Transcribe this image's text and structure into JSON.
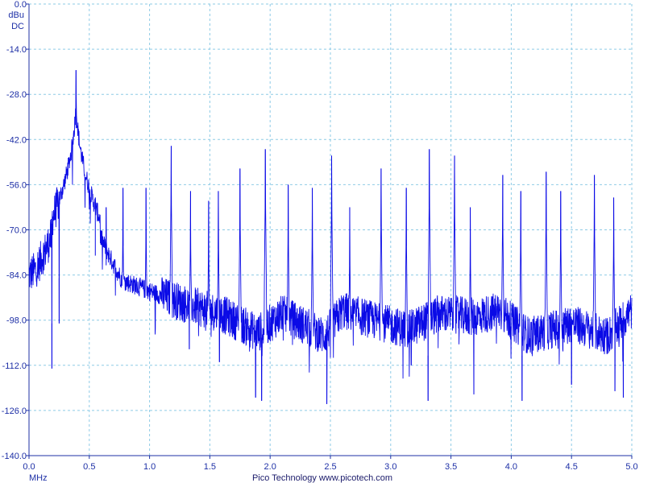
{
  "chart_data": {
    "type": "line",
    "y_unit": "dBu",
    "y_coupling": "DC",
    "x_unit": "MHz",
    "credit": "Pico Technology  www.picotech.com",
    "xlim": [
      0,
      5
    ],
    "ylim": [
      -140,
      0
    ],
    "x_ticks": [
      "0.0",
      "0.5",
      "1.0",
      "1.5",
      "2.0",
      "2.5",
      "3.0",
      "3.5",
      "4.0",
      "4.5",
      "5.0"
    ],
    "y_ticks": [
      "0.0",
      "-14.0",
      "-28.0",
      "-42.0",
      "-56.0",
      "-70.0",
      "-84.0",
      "-98.0",
      "-112.0",
      "-126.0",
      "-140.0"
    ],
    "grid": true,
    "series_color": "#0a0ae6",
    "grid_color": "#8ecbe6",
    "axis_color": "#1d2fa6",
    "peaks": [
      {
        "x": 0.39,
        "y": -20.5
      },
      {
        "x": 0.55,
        "y": -60
      },
      {
        "x": 0.64,
        "y": -63
      },
      {
        "x": 0.78,
        "y": -57
      },
      {
        "x": 0.97,
        "y": -57
      },
      {
        "x": 1.18,
        "y": -44
      },
      {
        "x": 1.34,
        "y": -58
      },
      {
        "x": 1.49,
        "y": -61
      },
      {
        "x": 1.57,
        "y": -58
      },
      {
        "x": 1.75,
        "y": -51
      },
      {
        "x": 1.96,
        "y": -45
      },
      {
        "x": 2.15,
        "y": -56
      },
      {
        "x": 2.35,
        "y": -57
      },
      {
        "x": 2.51,
        "y": -47
      },
      {
        "x": 2.66,
        "y": -63
      },
      {
        "x": 2.92,
        "y": -51
      },
      {
        "x": 3.13,
        "y": -57
      },
      {
        "x": 3.32,
        "y": -45
      },
      {
        "x": 3.53,
        "y": -47
      },
      {
        "x": 3.66,
        "y": -63
      },
      {
        "x": 3.93,
        "y": -53
      },
      {
        "x": 4.08,
        "y": -58
      },
      {
        "x": 4.29,
        "y": -52
      },
      {
        "x": 4.41,
        "y": -58
      },
      {
        "x": 4.69,
        "y": -53
      },
      {
        "x": 4.85,
        "y": -60
      }
    ],
    "noise_floor": [
      {
        "x": 0.0,
        "y": -84
      },
      {
        "x": 0.35,
        "y": -74
      },
      {
        "x": 0.5,
        "y": -82
      },
      {
        "x": 0.8,
        "y": -86
      },
      {
        "x": 1.0,
        "y": -89
      },
      {
        "x": 1.3,
        "y": -93
      },
      {
        "x": 1.6,
        "y": -96
      },
      {
        "x": 1.9,
        "y": -102
      },
      {
        "x": 2.1,
        "y": -96
      },
      {
        "x": 2.45,
        "y": -103
      },
      {
        "x": 2.6,
        "y": -95
      },
      {
        "x": 2.85,
        "y": -98
      },
      {
        "x": 3.15,
        "y": -101
      },
      {
        "x": 3.4,
        "y": -96
      },
      {
        "x": 3.7,
        "y": -97
      },
      {
        "x": 3.9,
        "y": -95
      },
      {
        "x": 4.15,
        "y": -103
      },
      {
        "x": 4.5,
        "y": -99
      },
      {
        "x": 4.8,
        "y": -103
      },
      {
        "x": 5.0,
        "y": -95
      }
    ],
    "dips": [
      {
        "x": 0.19,
        "y": -113
      },
      {
        "x": 0.25,
        "y": -99
      },
      {
        "x": 1.33,
        "y": -107
      },
      {
        "x": 1.58,
        "y": -111
      },
      {
        "x": 1.88,
        "y": -122
      },
      {
        "x": 1.93,
        "y": -123
      },
      {
        "x": 2.47,
        "y": -124
      },
      {
        "x": 3.17,
        "y": -112
      },
      {
        "x": 3.31,
        "y": -123
      },
      {
        "x": 3.69,
        "y": -121
      },
      {
        "x": 4.09,
        "y": -123
      },
      {
        "x": 4.5,
        "y": -118
      },
      {
        "x": 4.86,
        "y": -120
      },
      {
        "x": 4.93,
        "y": -122
      }
    ]
  }
}
